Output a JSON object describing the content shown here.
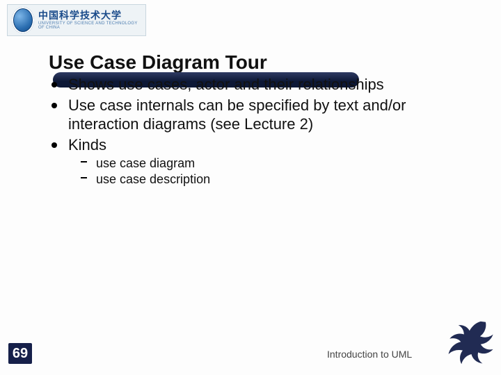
{
  "logo": {
    "cn": "中国科学技术大学",
    "en": "UNIVERSITY OF SCIENCE AND TECHNOLOGY OF CHINA"
  },
  "title": "Use Case Diagram Tour",
  "bullets": [
    "Shows use cases, actor and their relationships",
    "Use case internals can be specified by text and/or interaction diagrams (see Lecture 2)",
    "Kinds"
  ],
  "sub_bullets": [
    "use case diagram",
    "use case description"
  ],
  "page_number": "69",
  "footer": "Introduction to UML"
}
